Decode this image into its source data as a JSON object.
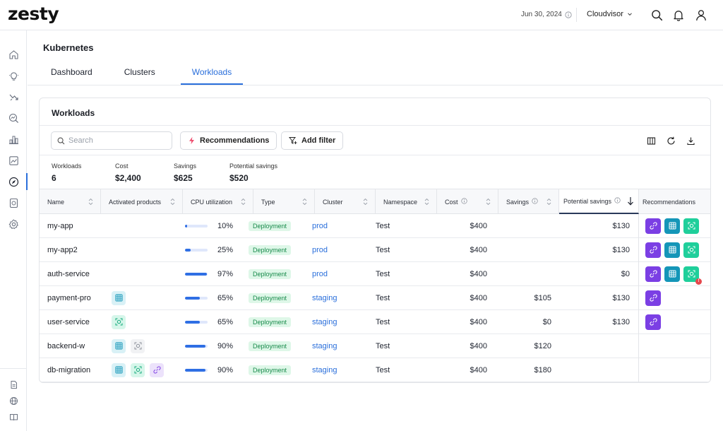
{
  "app": {
    "logo": "zesty"
  },
  "topbar": {
    "date": "Jun 30, 2024",
    "account": "Cloudvisor"
  },
  "page": {
    "title": "Kubernetes"
  },
  "tabs": [
    {
      "label": "Dashboard",
      "active": false
    },
    {
      "label": "Clusters",
      "active": false
    },
    {
      "label": "Workloads",
      "active": true
    }
  ],
  "card": {
    "title": "Workloads",
    "search_placeholder": "Search",
    "recommendations_btn": "Recommendations",
    "add_filter_btn": "Add filter"
  },
  "stats": [
    {
      "label": "Workloads",
      "value": "6"
    },
    {
      "label": "Cost",
      "value": "$2,400"
    },
    {
      "label": "Savings",
      "value": "$625"
    },
    {
      "label": "Potential savings",
      "value": "$520"
    }
  ],
  "columns": {
    "name": "Name",
    "activated_products": "Activated products",
    "cpu": "CPU utilization",
    "type": "Type",
    "cluster": "Cluster",
    "namespace": "Namespace",
    "cost": "Cost",
    "savings": "Savings",
    "potential_savings": "Potential savings",
    "recommendations": "Recommendations"
  },
  "rows": [
    {
      "name": "my-app",
      "products": [],
      "cpu_value": 0.1,
      "cpu": "10%",
      "type": "Deployment",
      "cluster": "prod",
      "namespace": "Test",
      "cost": "$400",
      "savings": "",
      "potential": "$130",
      "recs": [
        "link-purple",
        "grid-teal",
        "scan-green"
      ],
      "rec_alert": false
    },
    {
      "name": "my-app2",
      "products": [],
      "cpu_value": 0.25,
      "cpu": "25%",
      "type": "Deployment",
      "cluster": "prod",
      "namespace": "Test",
      "cost": "$400",
      "savings": "",
      "potential": "$130",
      "recs": [
        "link-purple",
        "grid-teal",
        "scan-green"
      ],
      "rec_alert": false
    },
    {
      "name": "auth-service",
      "products": [],
      "cpu_value": 0.97,
      "cpu": "97%",
      "type": "Deployment",
      "cluster": "prod",
      "namespace": "Test",
      "cost": "$400",
      "savings": "",
      "potential": "$0",
      "recs": [
        "link-purple",
        "grid-teal",
        "scan-green"
      ],
      "rec_alert": true
    },
    {
      "name": "payment-pro",
      "products": [
        "grid"
      ],
      "cpu_value": 0.65,
      "cpu": "65%",
      "type": "Deployment",
      "cluster": "staging",
      "namespace": "Test",
      "cost": "$400",
      "savings": "$105",
      "potential": "$130",
      "recs": [
        "link-purple"
      ],
      "rec_alert": false
    },
    {
      "name": "user-service",
      "products": [
        "scan"
      ],
      "cpu_value": 0.65,
      "cpu": "65%",
      "type": "Deployment",
      "cluster": "staging",
      "namespace": "Test",
      "cost": "$400",
      "savings": "$0",
      "potential": "$130",
      "recs": [
        "link-purple"
      ],
      "rec_alert": false
    },
    {
      "name": "backend-w",
      "products": [
        "grid",
        "scan-gray"
      ],
      "cpu_value": 0.9,
      "cpu": "90%",
      "type": "Deployment",
      "cluster": "staging",
      "namespace": "Test",
      "cost": "$400",
      "savings": "$120",
      "potential": "",
      "recs": [],
      "rec_alert": false
    },
    {
      "name": "db-migration",
      "products": [
        "grid",
        "scan",
        "link"
      ],
      "cpu_value": 0.9,
      "cpu": "90%",
      "type": "Deployment",
      "cluster": "staging",
      "namespace": "Test",
      "cost": "$400",
      "savings": "$180",
      "potential": "",
      "recs": [],
      "rec_alert": false
    }
  ],
  "colors": {
    "accent": "#2a6fdb",
    "purple": "#7b3fe4",
    "teal": "#1496b8",
    "green": "#1fcf9b",
    "badge_bg": "#def7e8",
    "badge_text": "#178a4a"
  }
}
